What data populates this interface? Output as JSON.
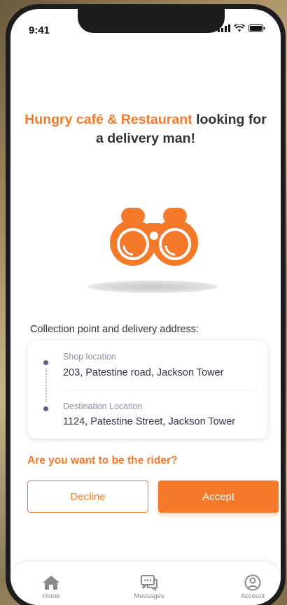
{
  "status_bar": {
    "time": "9:41"
  },
  "headline": {
    "brand": "Hungry café & Restaurant",
    "rest": " looking for a delivery man!"
  },
  "section_label": "Collection point and delivery address:",
  "addresses": {
    "shop": {
      "label": "Shop location",
      "value": "203, Patestine road, Jackson Tower"
    },
    "destination": {
      "label": "Destination Location",
      "value": "1124, Patestine Street, Jackson Tower"
    }
  },
  "question": "Are you want to be the rider?",
  "buttons": {
    "decline": "Decline",
    "accept": "Accept"
  },
  "tabs": [
    {
      "label": "Home",
      "icon": "home-icon"
    },
    {
      "label": "Messages",
      "icon": "messages-icon"
    },
    {
      "label": "Account",
      "icon": "account-icon"
    }
  ],
  "colors": {
    "accent": "#f47a2a",
    "text": "#333333",
    "muted": "#8b91a8"
  }
}
